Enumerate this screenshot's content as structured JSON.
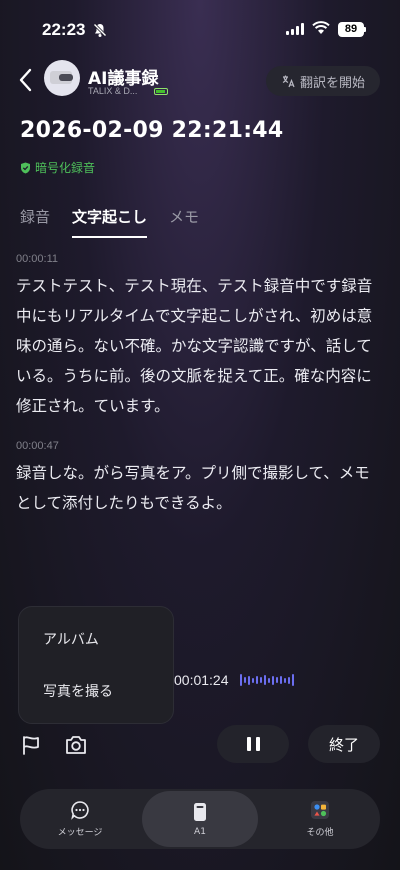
{
  "status_bar": {
    "time": "22:23",
    "battery": "89"
  },
  "header": {
    "device_name": "AI議事録",
    "device_sub": "TALIX & D...",
    "translate_label": "翻訳を開始"
  },
  "recording": {
    "title": "2026-02-09 22:21:44",
    "encryption_label": "暗号化録音"
  },
  "tabs": [
    {
      "label": "録音",
      "active": false
    },
    {
      "label": "文字起こし",
      "active": true
    },
    {
      "label": "メモ",
      "active": false
    }
  ],
  "transcript": [
    {
      "timestamp": "00:00:11",
      "text": "テストテスト、テスト現在、テスト録音中です録音中にもリアルタイムで文字起こしがされ、初めは意味の通ら。ない不確。かな文字認識ですが、話している。うちに前。後の文脈を捉えて正。確な内容に修正され。ています。"
    },
    {
      "timestamp": "00:00:47",
      "text": "録音しな。がら写真をア。プリ側で撮影して、メモとして添付したりもできるよ。"
    }
  ],
  "popup_menu": {
    "items": [
      "アルバム",
      "写真を撮る"
    ]
  },
  "recorder": {
    "elapsed": "00:01:24",
    "end_label": "終了",
    "icons": {
      "flag": "flag-icon",
      "camera": "camera-icon",
      "pause": "pause-icon"
    }
  },
  "bottom_nav": [
    {
      "label": "メッセージ",
      "icon": "message-icon",
      "active": false
    },
    {
      "label": "A1",
      "icon": "device-icon",
      "active": true
    },
    {
      "label": "その他",
      "icon": "apps-icon",
      "active": false
    }
  ],
  "colors": {
    "accent_green": "#4ec05a",
    "wave": "#6b6ef0",
    "background": "#1e1a2c"
  }
}
